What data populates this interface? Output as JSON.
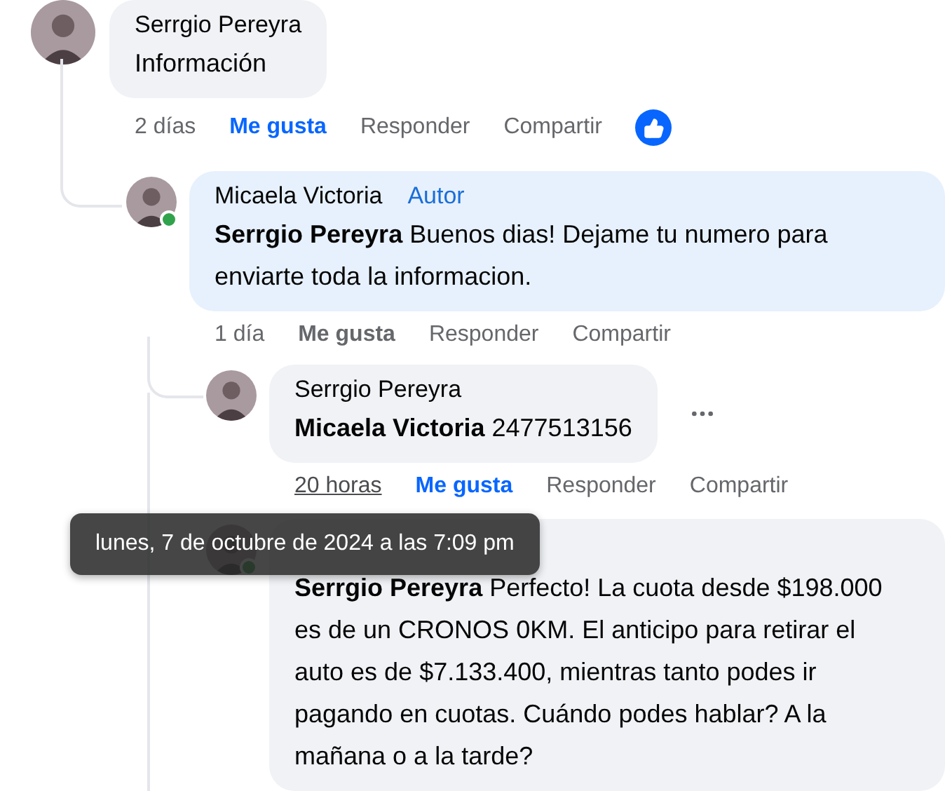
{
  "comments": [
    {
      "author": "Serrgio Pereyra",
      "online": false,
      "text": "Información",
      "time": "2 días",
      "time_hovered": false,
      "actions": [
        {
          "label": "Me gusta",
          "selected": true
        },
        {
          "label": "Responder",
          "selected": false
        },
        {
          "label": "Compartir",
          "selected": false
        }
      ],
      "reacted": true,
      "children": [
        {
          "author": "Micaela Victoria",
          "badge": "Autor",
          "online": true,
          "mention": "Serrgio Pereyra",
          "text": "Buenos dias! Dejame tu numero para enviarte toda la informacion.",
          "time": "1 día",
          "time_hovered": false,
          "actions": [
            {
              "label": "Me gusta",
              "selected": false
            },
            {
              "label": "Responder",
              "selected": false
            },
            {
              "label": "Compartir",
              "selected": false
            }
          ],
          "children": [
            {
              "author": "Serrgio Pereyra",
              "online": false,
              "mention": "Micaela Victoria",
              "text": "2477513156",
              "time": "20 horas",
              "time_hovered": true,
              "actions": [
                {
                  "label": "Me gusta",
                  "selected": true
                },
                {
                  "label": "Responder",
                  "selected": false
                },
                {
                  "label": "Compartir",
                  "selected": false
                }
              ],
              "menu_visible": true
            },
            {
              "online": true,
              "mention": "Serrgio Pereyra",
              "text": "Perfecto! La cuota desde $198.000 es de un CRONOS 0KM. El anticipo para retirar el auto es de $7.133.400, mientras tanto podes ir pagando en cuotas. Cuándo podes hablar? A la mañana o a la tarde?"
            }
          ]
        }
      ]
    }
  ],
  "tooltip": "lunes, 7 de octubre de 2024 a las 7:09 pm"
}
